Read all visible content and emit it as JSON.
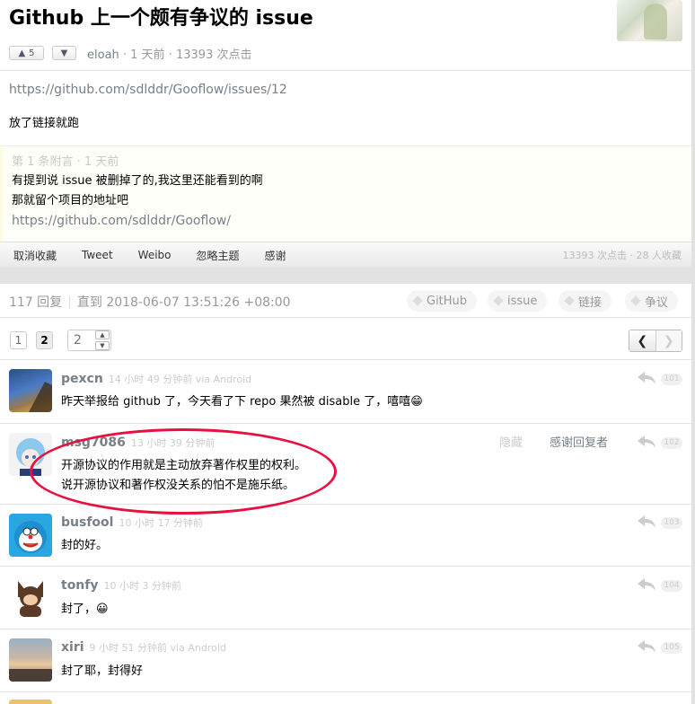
{
  "topic": {
    "title": "Github 上一个颇有争议的 issue",
    "upvote_count": "5",
    "author": "eloah",
    "meta_suffix": " · 1 天前 · 13393 次点击",
    "link": "https://github.com/sdlddr/Gooflow/issues/12",
    "text": "放了链接就跑",
    "appendix": {
      "header": "第 1 条附言 · 1 天前",
      "lines": [
        "有提到说 issue 被删掉了的,我这里还能看到的啊",
        "那就留个项目的地址吧"
      ],
      "link": "https://github.com/sdlddr/Gooflow/"
    },
    "toolbar": {
      "unfavorite": "取消收藏",
      "tweet": "Tweet",
      "weibo": "Weibo",
      "ignore": "忽略主题",
      "thank": "感谢",
      "stats": "13393 次点击 · 28 人收藏"
    }
  },
  "replies_header": {
    "count": "117 回复",
    "until": "直到 2018-06-07 13:51:26 +08:00",
    "tags": [
      "GitHub",
      "issue",
      "链接",
      "争议"
    ]
  },
  "pager": {
    "pages": [
      "1",
      "2"
    ],
    "jump_placeholder": "2"
  },
  "replies": [
    {
      "user": "pexcn",
      "time": "14 小时 49 分钟前 via Android",
      "lines": [
        "昨天举报给 github 了，今天看了下 repo 果然被 disable 了，嘻嘻😁"
      ],
      "floor": "101"
    },
    {
      "user": "msg7086",
      "time": "13 小时 39 分钟前",
      "lines": [
        "开源协议的作用就是主动放弃著作权里的权利。",
        "说开源协议和著作权没关系的怕不是施乐纸。"
      ],
      "floor": "102",
      "hide": "隐藏",
      "thank_reply": "感谢回复者"
    },
    {
      "user": "busfool",
      "time": "10 小时 17 分钟前",
      "lines": [
        "封的好。"
      ],
      "floor": "103"
    },
    {
      "user": "tonfy",
      "time": "10 小时 3 分钟前",
      "lines": [
        "封了，😀"
      ],
      "floor": "104"
    },
    {
      "user": "xiri",
      "time": "9 小时 51 分钟前 via Android",
      "lines": [
        "封了耶，封得好"
      ],
      "floor": "105"
    }
  ]
}
